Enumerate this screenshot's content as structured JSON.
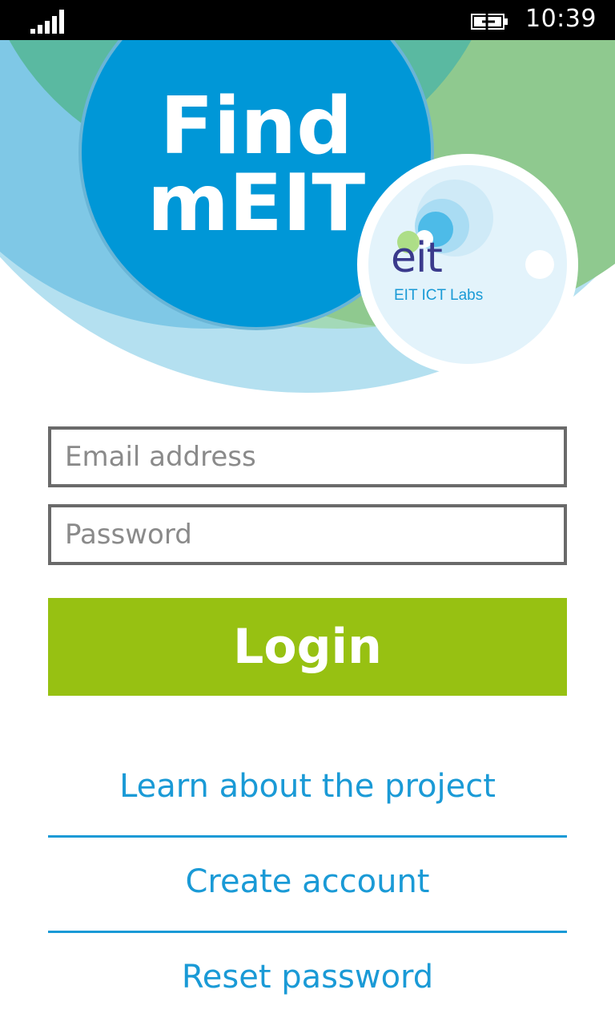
{
  "status_bar": {
    "time": "10:39"
  },
  "header": {
    "title_line1": "Find",
    "title_line2": "mEIT",
    "logo_word": "eit",
    "logo_subtitle": "EIT ICT Labs"
  },
  "form": {
    "email_placeholder": "Email address",
    "password_placeholder": "Password",
    "login_label": "Login"
  },
  "links": {
    "learn": "Learn about the project",
    "create": "Create account",
    "reset": "Reset password"
  },
  "colors": {
    "accent_blue": "#1a9ad6",
    "login_green": "#97c112",
    "status_bg": "#000000"
  }
}
